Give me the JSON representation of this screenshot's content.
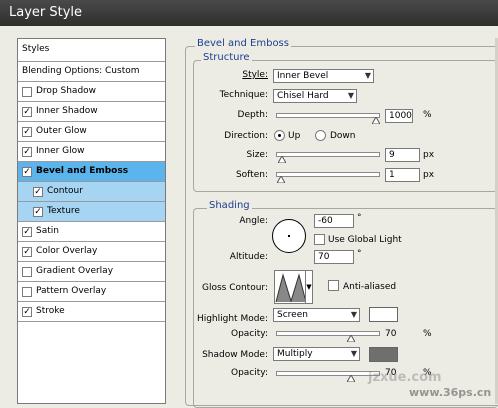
{
  "window": {
    "title": "Layer Style"
  },
  "styles_list": {
    "header": "Styles",
    "blending": "Blending Options: Custom",
    "items": [
      {
        "label": "Drop Shadow",
        "checked": false
      },
      {
        "label": "Inner Shadow",
        "checked": true
      },
      {
        "label": "Outer Glow",
        "checked": true
      },
      {
        "label": "Inner Glow",
        "checked": true
      },
      {
        "label": "Bevel and Emboss",
        "checked": true
      },
      {
        "label": "Contour",
        "checked": true
      },
      {
        "label": "Texture",
        "checked": true
      },
      {
        "label": "Satin",
        "checked": true
      },
      {
        "label": "Color Overlay",
        "checked": true
      },
      {
        "label": "Gradient Overlay",
        "checked": false
      },
      {
        "label": "Pattern Overlay",
        "checked": false
      },
      {
        "label": "Stroke",
        "checked": true
      }
    ]
  },
  "bevel": {
    "title": "Bevel and Emboss",
    "structure": {
      "title": "Structure",
      "style_label": "Style:",
      "style_value": "Inner Bevel",
      "technique_label": "Technique:",
      "technique_value": "Chisel Hard",
      "depth_label": "Depth:",
      "depth_value": "1000",
      "depth_unit": "%",
      "direction_label": "Direction:",
      "direction_up": "Up",
      "direction_down": "Down",
      "size_label": "Size:",
      "size_value": "9",
      "size_unit": "px",
      "soften_label": "Soften:",
      "soften_value": "1",
      "soften_unit": "px"
    },
    "shading": {
      "title": "Shading",
      "angle_label": "Angle:",
      "angle_value": "-60",
      "degree": "°",
      "global_light_label": "Use Global Light",
      "altitude_label": "Altitude:",
      "altitude_value": "70",
      "gloss_label": "Gloss Contour:",
      "anti_aliased_label": "Anti-aliased",
      "highlight_label": "Highlight Mode:",
      "highlight_value": "Screen",
      "opacity_label": "Opacity:",
      "highlight_opacity": "70",
      "shadow_label": "Shadow Mode:",
      "shadow_value": "Multiply",
      "shadow_opacity": "70",
      "pct": "%",
      "highlight_color": "#ffffff",
      "shadow_color": "#6f6f6f"
    }
  },
  "watermark": {
    "site": "www.36ps.cn",
    "domain": "jzxue.com"
  }
}
